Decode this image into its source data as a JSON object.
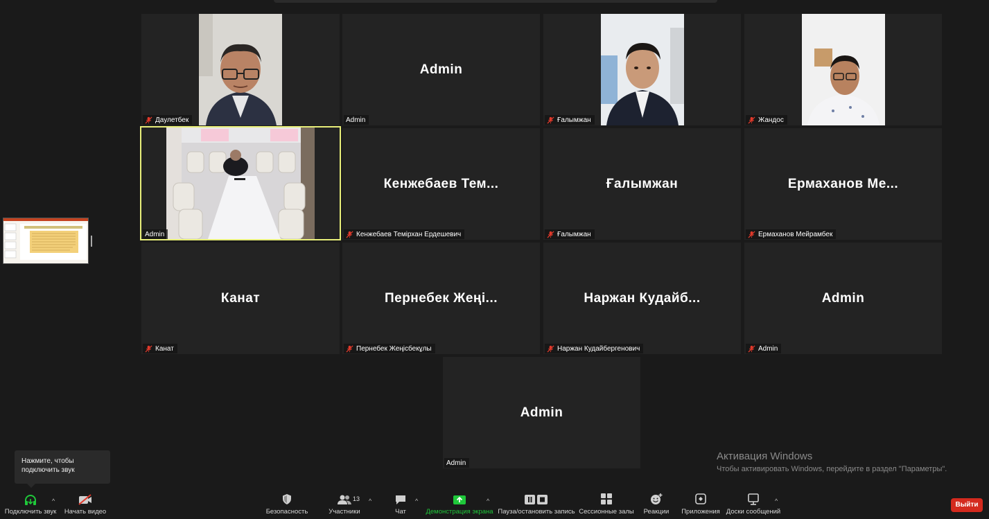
{
  "tiles": [
    {
      "name": "Даулетбек",
      "center": "",
      "video": true
    },
    {
      "name": "Admin",
      "center": "Admin",
      "video": false
    },
    {
      "name": "Ғалымжан",
      "center": "",
      "video": true
    },
    {
      "name": "Жандос",
      "center": "",
      "video": true
    },
    {
      "name": "Admin",
      "center": "",
      "video": true
    },
    {
      "name": "Кенжебаев Темірхан Ердешевич",
      "center": "Кенжебаев Тем...",
      "video": false
    },
    {
      "name": "Ғалымжан",
      "center": "Ғалымжан",
      "video": false
    },
    {
      "name": "Ермаханов Мейрамбек",
      "center": "Ермаханов Ме...",
      "video": false
    },
    {
      "name": "Канат",
      "center": "Канат",
      "video": false
    },
    {
      "name": "Пернебек Жеңісбекұлы",
      "center": "Пернебек Жеңі...",
      "video": false
    },
    {
      "name": "Наржан Кудайбергенович",
      "center": "Наржан Кудайб...",
      "video": false
    },
    {
      "name": "Admin",
      "center": "Admin",
      "video": false
    },
    {
      "name": "Admin",
      "center": "Admin",
      "video": false
    }
  ],
  "tooltip": {
    "line1": "Нажмите, чтобы",
    "line2": "подключить звук"
  },
  "activation": {
    "title": "Активация Windows",
    "subtitle": "Чтобы активировать Windows, перейдите в раздел \"Параметры\"."
  },
  "toolbar": {
    "audio": "Подключить звук",
    "video": "Начать видео",
    "security": "Безопасность",
    "participants": "Участники",
    "participants_count": "13",
    "chat": "Чат",
    "share": "Демонстрация экрана",
    "record": "Пауза/остановить запись",
    "breakout": "Сессионные залы",
    "reactions": "Реакции",
    "apps": "Приложения",
    "whiteboards": "Доски сообщений",
    "leave": "Выйти",
    "caret": "^"
  },
  "colors": {
    "share_green": "#1fc83a",
    "leave_red": "#d42a1e",
    "active_speaker": "#e8ef7a",
    "muted_red": "#e0392b"
  }
}
